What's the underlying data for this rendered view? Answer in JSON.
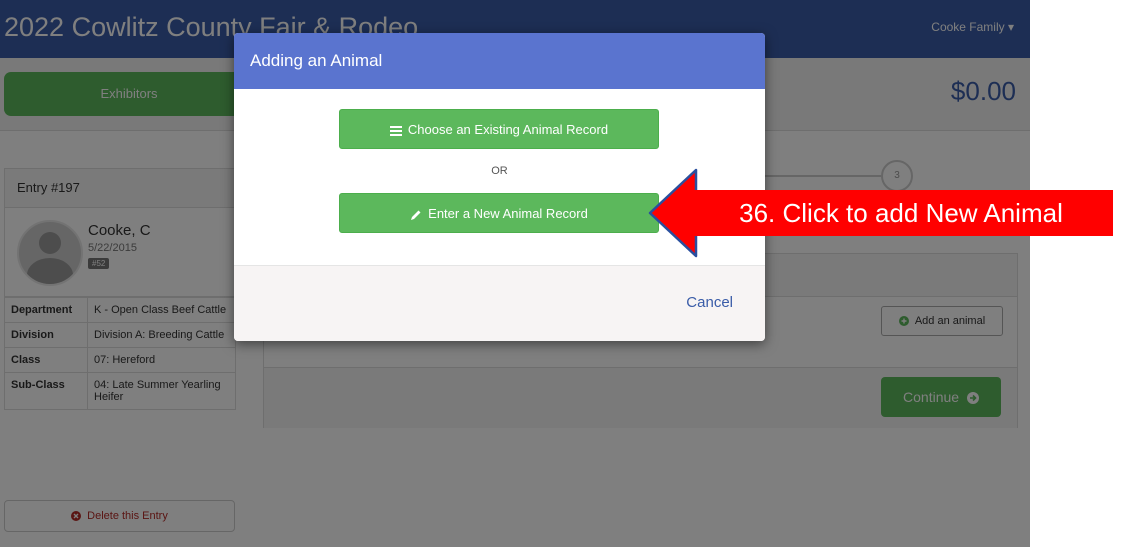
{
  "app": {
    "title": "2022 Cowlitz County Fair & Rodeo",
    "user_menu": "Cooke Family ▾",
    "exhibitors_label": "Exhibitors",
    "total": "$0.00",
    "step_number": "3"
  },
  "entry": {
    "header": "Entry #197",
    "name": "Cooke, C",
    "date": "5/22/2015",
    "badge": "#52",
    "details": [
      {
        "key": "Department",
        "value": "K - Open Class Beef Cattle"
      },
      {
        "key": "Division",
        "value": "Division A: Breeding Cattle"
      },
      {
        "key": "Class",
        "value": "07: Hereford"
      },
      {
        "key": "Sub-Class",
        "value": "04: Late Summer Yearling Heifer"
      }
    ],
    "delete_label": "Delete this Entry"
  },
  "animals_panel": {
    "add_label": "Add an animal",
    "continue_label": "Continue"
  },
  "modal": {
    "title": "Adding an Animal",
    "choose_label": "Choose an Existing Animal Record",
    "or_text": "OR",
    "new_label": "Enter a New Animal Record",
    "cancel_label": "Cancel"
  },
  "callout": {
    "text": "36. Click to add New Animal",
    "color": "#ff0000"
  },
  "colors": {
    "navbar": "#3a5ca8",
    "modal_header": "#5a74cf",
    "success": "#5cb85c",
    "danger": "#b52b27"
  }
}
